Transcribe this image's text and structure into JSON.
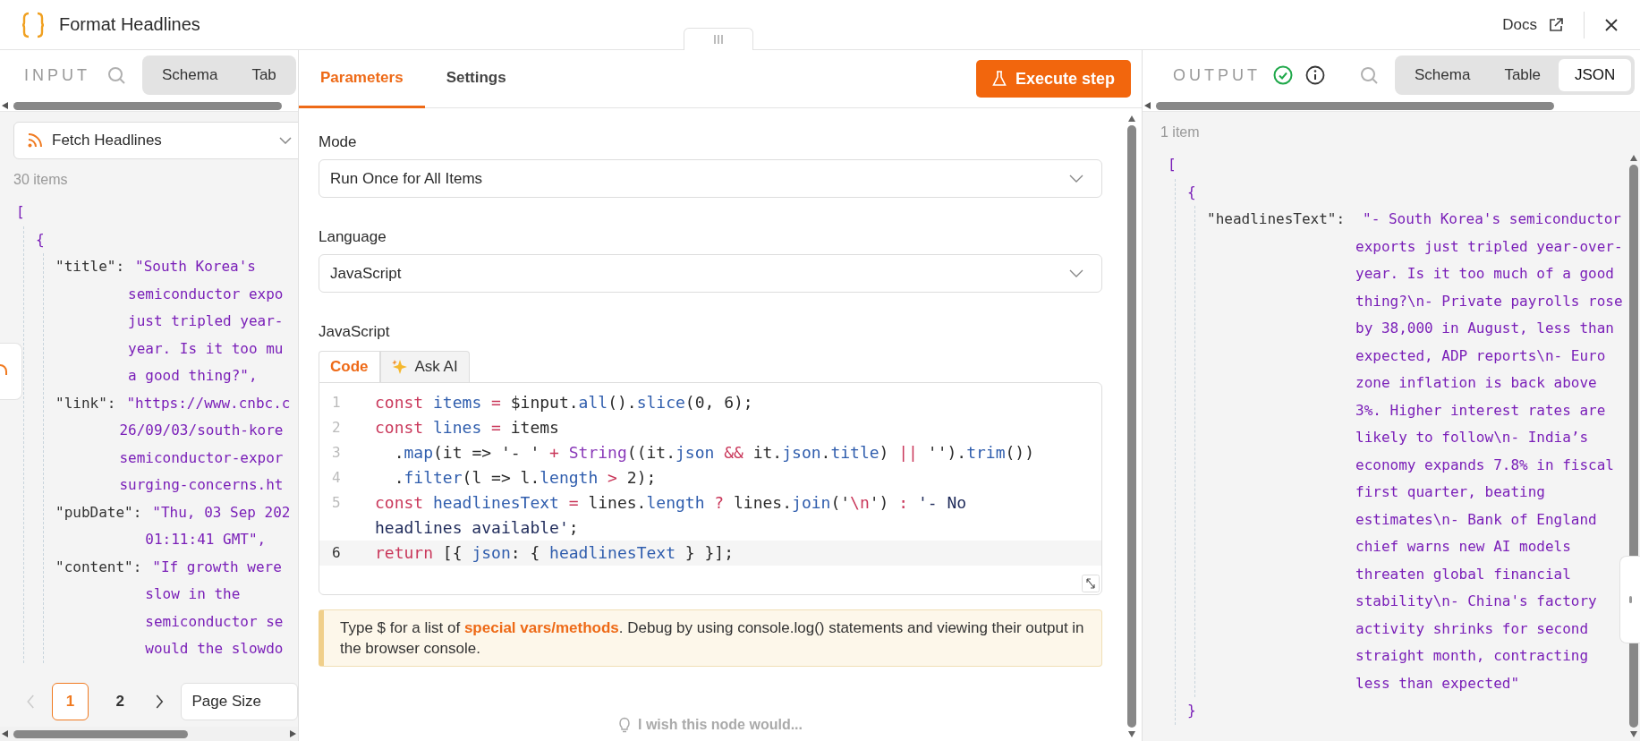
{
  "header": {
    "title": "Format Headlines",
    "docs_link": "Docs"
  },
  "input_panel": {
    "label": "INPUT",
    "tabs": [
      {
        "label": "Schema",
        "selected": false
      },
      {
        "label": "Tab",
        "selected": false
      }
    ],
    "source": "Fetch Headlines",
    "count": "30 items",
    "json": {
      "open": "[",
      "children": [
        {
          "open": "{",
          "children": [
            {
              "key": "\"title\":",
              "lines": [
                "\"South Korea's",
                "semiconductor expo",
                "just tripled year-",
                "year. Is it too mu",
                "a good thing?\","
              ]
            },
            {
              "key": "\"link\":",
              "lines": [
                "\"https://www.cnbc.c",
                "26/09/03/south-kore",
                "semiconductor-expor",
                "surging-concerns.ht"
              ]
            },
            {
              "key": "\"pubDate\":",
              "lines": [
                "\"Thu, 03 Sep 202",
                "01:11:41 GMT\","
              ]
            },
            {
              "key": "\"content\":",
              "lines": [
                "\"If growth were",
                "slow in the",
                "semiconductor se",
                "would the slowdo"
              ]
            }
          ]
        }
      ]
    },
    "pages": [
      {
        "label": "1",
        "selected": true
      },
      {
        "label": "2",
        "selected": false
      }
    ],
    "page_size_label": "Page Size"
  },
  "node_panel": {
    "tabs": [
      {
        "label": "Parameters",
        "selected": true
      },
      {
        "label": "Settings",
        "selected": false
      }
    ],
    "execute_button": "Execute step",
    "fields": [
      {
        "label": "Mode",
        "value": "Run Once for All Items"
      },
      {
        "label": "Language",
        "value": "JavaScript"
      }
    ],
    "code_label": "JavaScript",
    "code_tabs": [
      {
        "label": "Code",
        "selected": true
      },
      {
        "label": "Ask AI",
        "selected": false
      }
    ],
    "code_lines": [
      {
        "number": "1",
        "active": false,
        "tokens": [
          {
            "text": "const ",
            "kind": "keyword"
          },
          {
            "text": "items ",
            "kind": "name"
          },
          {
            "text": "= ",
            "kind": "operator"
          },
          {
            "text": "$input.",
            "kind": "plain"
          },
          {
            "text": "all",
            "kind": "name"
          },
          {
            "text": "().",
            "kind": "plain"
          },
          {
            "text": "slice",
            "kind": "name"
          },
          {
            "text": "(0, 6);",
            "kind": "plain"
          }
        ]
      },
      {
        "number": "2",
        "active": false,
        "tokens": [
          {
            "text": "const ",
            "kind": "keyword"
          },
          {
            "text": "lines ",
            "kind": "name"
          },
          {
            "text": "= ",
            "kind": "operator"
          },
          {
            "text": "items",
            "kind": "plain"
          }
        ]
      },
      {
        "number": "3",
        "active": false,
        "tokens": [
          {
            "text": "  .",
            "kind": "plain"
          },
          {
            "text": "map",
            "kind": "name"
          },
          {
            "text": "(it => '- ' ",
            "kind": "plain"
          },
          {
            "text": "+ ",
            "kind": "operator"
          },
          {
            "text": "String",
            "kind": "builtin"
          },
          {
            "text": "((it.",
            "kind": "plain"
          },
          {
            "text": "json ",
            "kind": "name"
          },
          {
            "text": "&& ",
            "kind": "operator"
          },
          {
            "text": "it.",
            "kind": "plain"
          },
          {
            "text": "json",
            "kind": "name"
          },
          {
            "text": ".",
            "kind": "plain"
          },
          {
            "text": "title",
            "kind": "name"
          },
          {
            "text": ") ",
            "kind": "plain"
          },
          {
            "text": "|| ",
            "kind": "operator"
          },
          {
            "text": "'').",
            "kind": "plain"
          },
          {
            "text": "trim",
            "kind": "name"
          },
          {
            "text": "())",
            "kind": "plain"
          }
        ]
      },
      {
        "number": "4",
        "active": false,
        "tokens": [
          {
            "text": "  .",
            "kind": "plain"
          },
          {
            "text": "filter",
            "kind": "name"
          },
          {
            "text": "(l => l.",
            "kind": "plain"
          },
          {
            "text": "length ",
            "kind": "name"
          },
          {
            "text": "> ",
            "kind": "operator"
          },
          {
            "text": "2);",
            "kind": "plain"
          }
        ]
      },
      {
        "number": "5",
        "active": false,
        "tokens": [
          {
            "text": "const ",
            "kind": "keyword"
          },
          {
            "text": "headlinesText ",
            "kind": "name"
          },
          {
            "text": "= ",
            "kind": "operator"
          },
          {
            "text": "lines.",
            "kind": "plain"
          },
          {
            "text": "length ",
            "kind": "name"
          },
          {
            "text": "? ",
            "kind": "operator"
          },
          {
            "text": "lines.",
            "kind": "plain"
          },
          {
            "text": "join",
            "kind": "name"
          },
          {
            "text": "('",
            "kind": "plain"
          },
          {
            "text": "\\n",
            "kind": "operator"
          },
          {
            "text": "') ",
            "kind": "plain"
          },
          {
            "text": ": ",
            "kind": "operator"
          },
          {
            "text": "'- No",
            "kind": "string"
          }
        ]
      },
      {
        "tokens": [
          {
            "text": "headlines available'",
            "kind": "string"
          },
          {
            "text": ";",
            "kind": "plain"
          }
        ]
      },
      {
        "number": "6",
        "active": true,
        "tokens": [
          {
            "text": "return ",
            "kind": "keyword"
          },
          {
            "text": "[{ ",
            "kind": "plain"
          },
          {
            "text": "json",
            "kind": "name"
          },
          {
            "text": ": { ",
            "kind": "plain"
          },
          {
            "text": "headlinesText ",
            "kind": "name"
          },
          {
            "text": "} }];",
            "kind": "plain"
          }
        ]
      }
    ],
    "notice": {
      "before": "Type $ for a list of ",
      "link": "special vars/methods",
      "after": ". Debug by using console.log() statements and viewing their output in the browser console."
    },
    "feedback": "I wish this node would..."
  },
  "output_panel": {
    "label": "OUTPUT",
    "succeeded": true,
    "tabs": [
      {
        "label": "Schema",
        "selected": false
      },
      {
        "label": "Table",
        "selected": false
      },
      {
        "label": "JSON",
        "selected": true
      }
    ],
    "count": "1 item",
    "json": {
      "open": "[",
      "children": [
        {
          "open": "{",
          "close": "}",
          "children": [
            {
              "key": "\"headlinesText\":",
              "lines": [
                "\"- South Korea's semiconductor",
                "exports just tripled year-over-",
                "year. Is it too much of a good",
                "thing?\\n- Private payrolls rose",
                "by 38,000 in August, less than",
                "expected, ADP reports\\n- Euro",
                "zone inflation is back above",
                "3%. Higher interest rates are",
                "likely to follow\\n- India’s",
                "economy expands 7.8% in fiscal",
                "first quarter, beating",
                "estimates\\n- Bank of England",
                "chief warns new AI models",
                "threaten global financial",
                "stability\\n- China's factory",
                "activity shrinks for second",
                "straight month, contracting",
                "less than expected\""
              ]
            }
          ]
        }
      ]
    }
  }
}
